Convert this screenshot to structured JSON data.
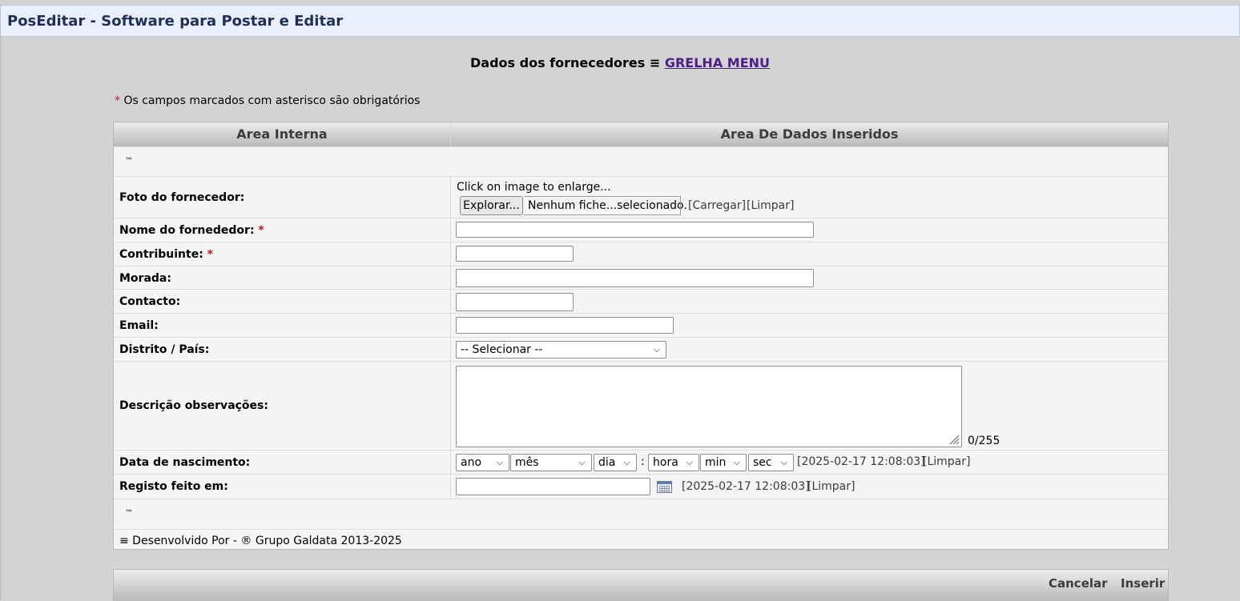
{
  "window": {
    "title": "PosEditar - Software para Postar e Editar"
  },
  "heading": {
    "prefix": "Dados dos fornecedores ≡",
    "link": "GRELHA MENU"
  },
  "note": {
    "star": "*",
    "text": "Os campos marcados com asterisco são obrigatórios"
  },
  "table": {
    "col_left": "Area Interna",
    "col_right": "Area De Dados Inseridos",
    "tm_top": "™",
    "tm_bottom": "™",
    "footer": "≡ Desenvolvido Por - ® Grupo Galdata 2013-2025"
  },
  "fields": {
    "photo": {
      "label": "Foto do fornecedor:",
      "hint": "Click on image to enlarge...",
      "browse": "Explorar...",
      "file": "Nenhum fiche...selecionado.",
      "upload": "[Carregar]",
      "clear": "[Limpar]"
    },
    "name": {
      "label": "Nome do fornededor:",
      "required": "*",
      "value": ""
    },
    "taxid": {
      "label": "Contribuinte:",
      "required": "*",
      "value": ""
    },
    "address": {
      "label": "Morada:",
      "value": ""
    },
    "contact": {
      "label": "Contacto:",
      "value": ""
    },
    "email": {
      "label": "Email:",
      "value": ""
    },
    "district": {
      "label": "Distrito / País:",
      "selected": "-- Selecionar --"
    },
    "description": {
      "label": "Descrição observações:",
      "value": "",
      "counter": "0/255"
    },
    "birth": {
      "label": "Data de nascimento:",
      "year": "ano",
      "month": "mês",
      "day": "dia",
      "sep": ":",
      "hour": "hora",
      "min": "min",
      "sec": "sec",
      "stamp": "[2025-02-17 12:08:03]",
      "clear": "[Limpar]"
    },
    "registered": {
      "label": "Registo feito em:",
      "value": "",
      "stamp": "[2025-02-17 12:08:03]",
      "clear": "[Limpar]"
    }
  },
  "actions": {
    "cancel": "Cancelar",
    "insert": "Inserir"
  },
  "colors": {
    "topbar_bg": "#e9effd",
    "title": "#1f2f56",
    "link": "#4b1f86",
    "required": "#c01414",
    "page_bg": "#d3d3d3"
  },
  "icons": {
    "select_arrow": "chevron-down-icon",
    "calendar": "calendar-icon",
    "resize": "resize-grip-icon"
  }
}
